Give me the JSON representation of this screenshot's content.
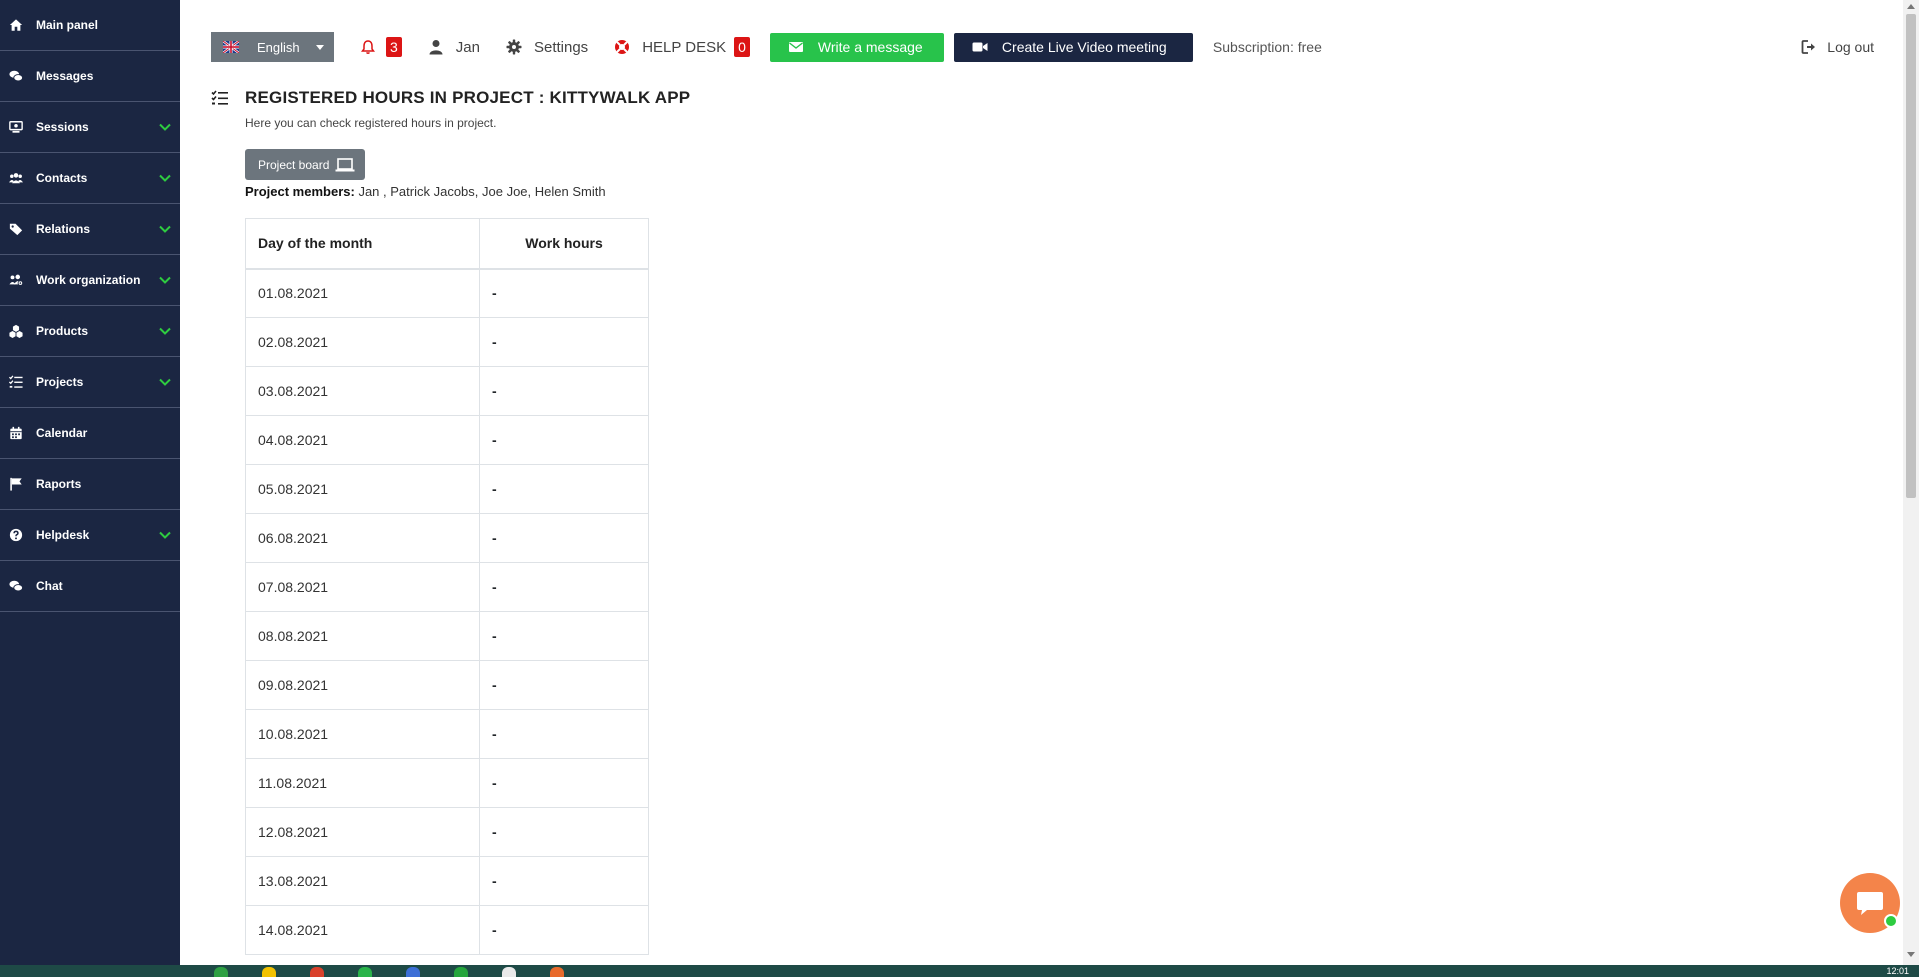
{
  "sidebar": {
    "items": [
      {
        "label": "Main panel",
        "icon": "home-icon",
        "expandable": false
      },
      {
        "label": "Messages",
        "icon": "messages-icon",
        "expandable": false
      },
      {
        "label": "Sessions",
        "icon": "sessions-icon",
        "expandable": true
      },
      {
        "label": "Contacts",
        "icon": "contacts-icon",
        "expandable": true
      },
      {
        "label": "Relations",
        "icon": "tags-icon",
        "expandable": true
      },
      {
        "label": "Work organization",
        "icon": "users-cog-icon",
        "expandable": true
      },
      {
        "label": "Products",
        "icon": "cubes-icon",
        "expandable": true
      },
      {
        "label": "Projects",
        "icon": "tasks-icon",
        "expandable": true
      },
      {
        "label": "Calendar",
        "icon": "calendar-icon",
        "expandable": false
      },
      {
        "label": "Raports",
        "icon": "flag-icon",
        "expandable": false
      },
      {
        "label": "Helpdesk",
        "icon": "question-circle-icon",
        "expandable": true
      },
      {
        "label": "Chat",
        "icon": "chat-icon",
        "expandable": false
      }
    ],
    "chevron_color": "#2ecc40"
  },
  "header": {
    "language": "English",
    "notifications_count": "3",
    "user_name": "Jan",
    "settings_label": "Settings",
    "helpdesk_label": "HELP DESK",
    "helpdesk_count": "0",
    "write_message_label": "Write a message",
    "video_meeting_label": "Create Live Video meeting",
    "subscription": "Subscription: free",
    "logout_label": "Log out"
  },
  "main": {
    "title": "REGISTERED HOURS IN PROJECT : KITTYWALK APP",
    "subtitle": "Here you can check registered hours in project.",
    "project_board_label": "Project board",
    "members_label": "Project members:",
    "members": "Jan , Patrick Jacobs, Joe Joe, Helen Smith",
    "table": {
      "headers": [
        "Day of the month",
        "Work hours"
      ],
      "rows": [
        [
          "01.08.2021",
          "-"
        ],
        [
          "02.08.2021",
          "-"
        ],
        [
          "03.08.2021",
          "-"
        ],
        [
          "04.08.2021",
          "-"
        ],
        [
          "05.08.2021",
          "-"
        ],
        [
          "06.08.2021",
          "-"
        ],
        [
          "07.08.2021",
          "-"
        ],
        [
          "08.08.2021",
          "-"
        ],
        [
          "09.08.2021",
          "-"
        ],
        [
          "10.08.2021",
          "-"
        ],
        [
          "11.08.2021",
          "-"
        ],
        [
          "12.08.2021",
          "-"
        ],
        [
          "13.08.2021",
          "-"
        ],
        [
          "14.08.2021",
          "-"
        ]
      ]
    }
  },
  "taskbar": {
    "clock": "12:01"
  },
  "colors": {
    "sidebar_bg": "#1b2642",
    "accent_green": "#28c34b",
    "badge_red": "#dc1515",
    "chat_orange": "#f4844a"
  }
}
